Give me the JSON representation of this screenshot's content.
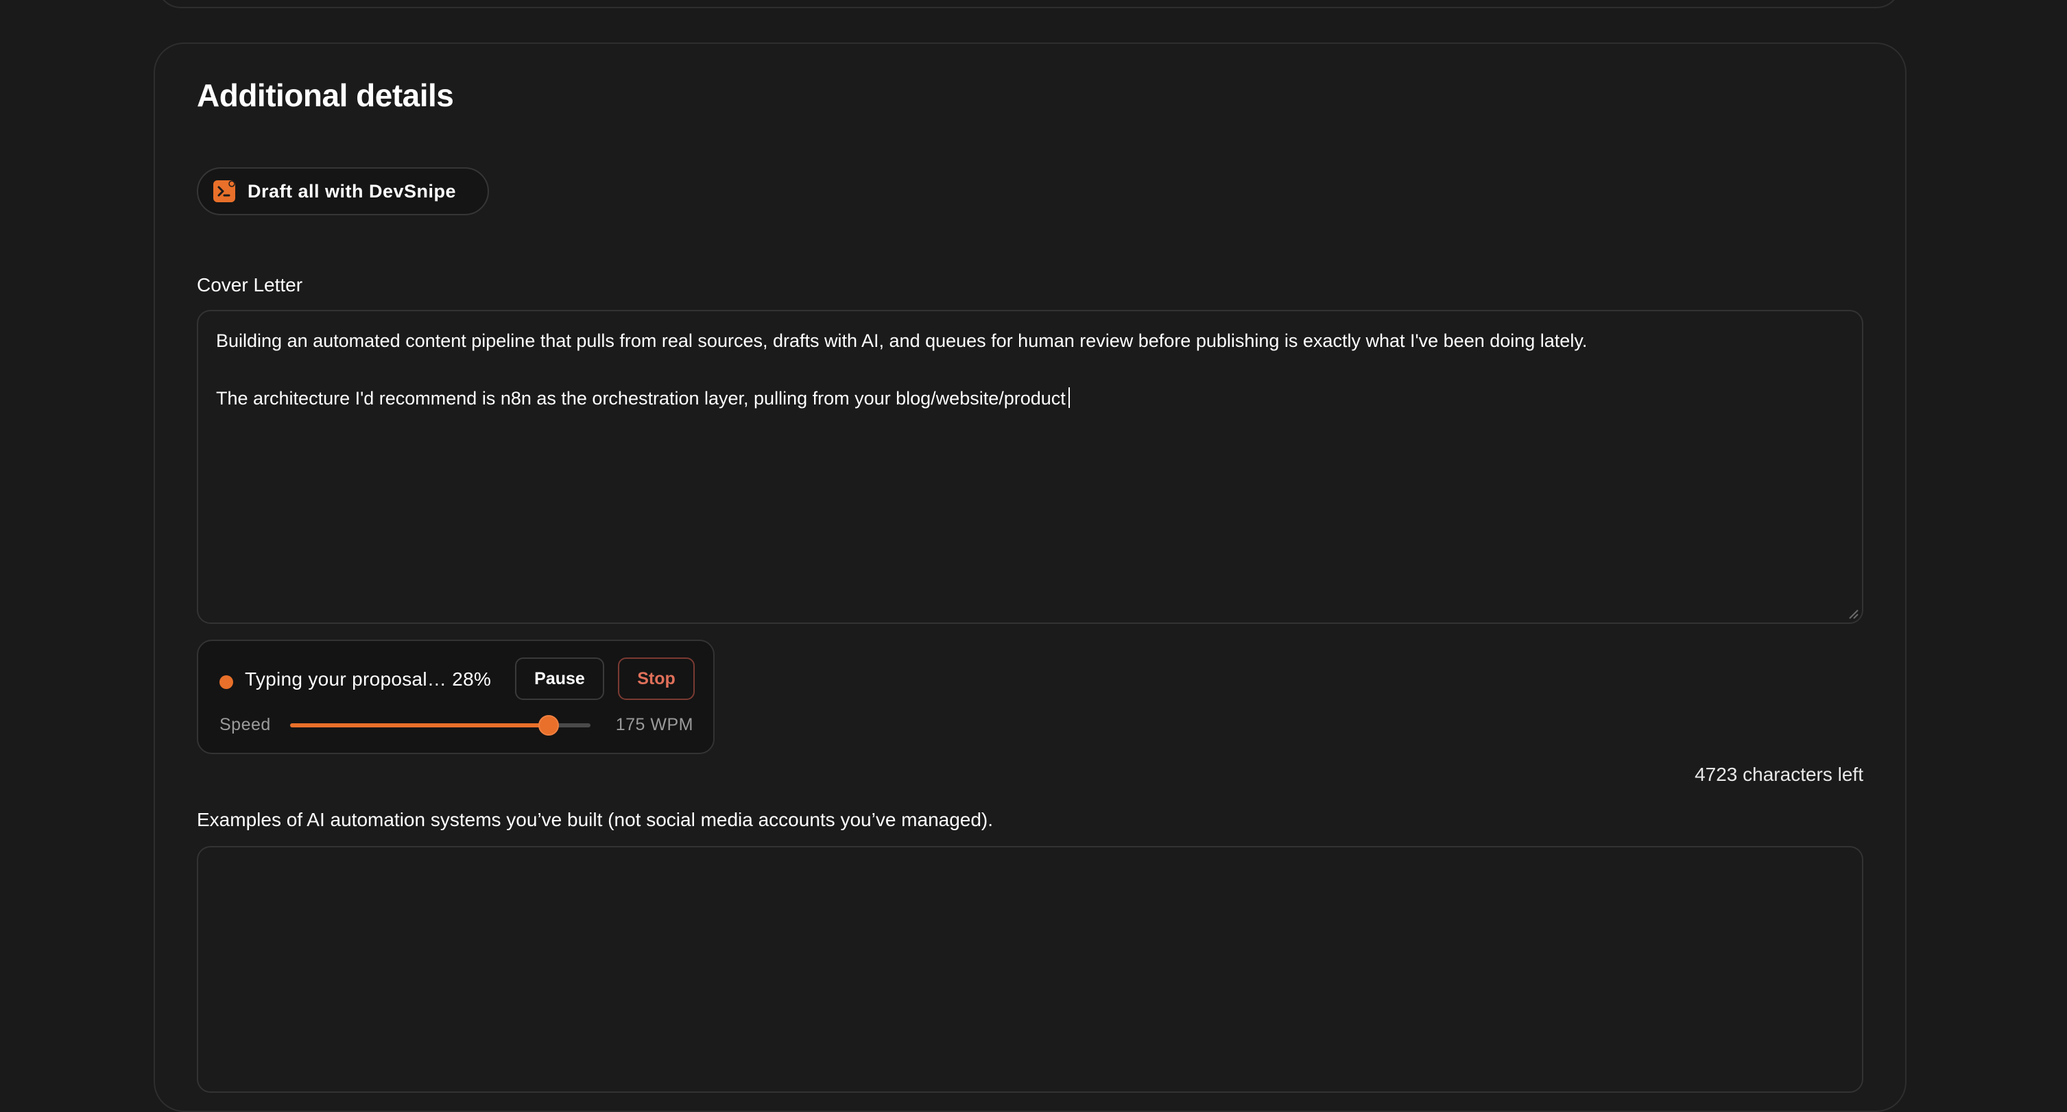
{
  "section": {
    "title": "Additional details",
    "draft_button_label": "Draft all with DevSnipe"
  },
  "cover_letter": {
    "label": "Cover Letter",
    "paragraphs": [
      "Building an automated content pipeline that pulls from real sources, drafts with AI, and queues for human review before publishing is exactly what I've been doing lately.",
      "The architecture I'd recommend is n8n as the orchestration layer, pulling from your blog/website/product"
    ],
    "chars_left": "4723 characters left"
  },
  "typing_panel": {
    "status_text": "Typing your proposal… 28%",
    "progress_percent": 28,
    "pause_label": "Pause",
    "stop_label": "Stop",
    "speed_label": "Speed",
    "speed_fraction": 0.86,
    "wpm_text": "175 WPM",
    "accent_color": "#e8702a"
  },
  "examples": {
    "label": "Examples of AI automation systems you’ve built (not social media accounts you’ve managed)."
  },
  "icons": {
    "draft": "devsnipe-terminal-icon",
    "status": "typing-status-dot-icon",
    "resize": "resize-grip-icon"
  }
}
